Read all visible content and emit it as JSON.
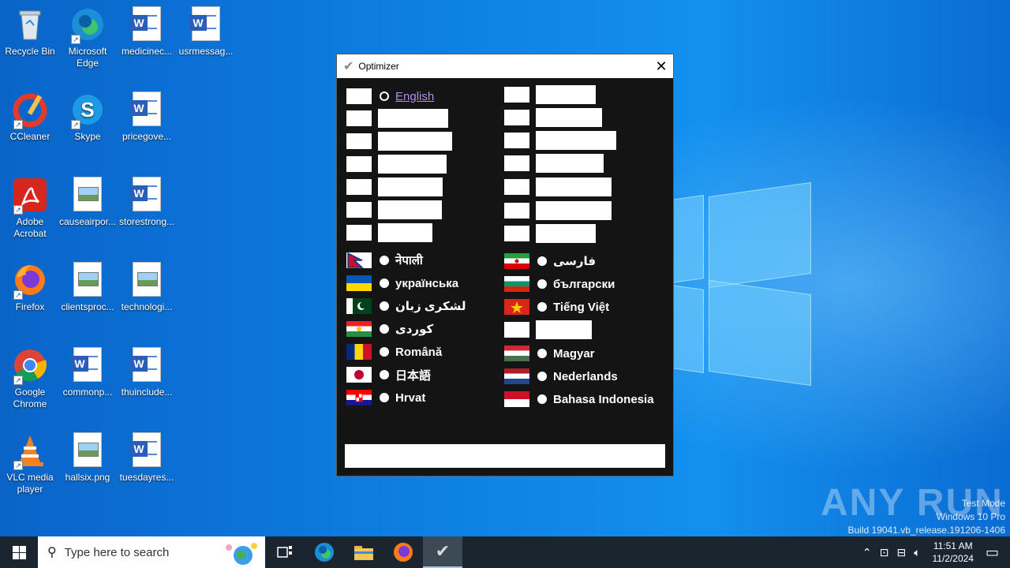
{
  "desktop": {
    "icons": [
      {
        "label": "Recycle Bin",
        "icon": "recycle-bin-icon"
      },
      {
        "label": "Microsoft Edge",
        "icon": "edge-icon"
      },
      {
        "label": "medicinec...",
        "icon": "word-doc-icon"
      },
      {
        "label": "usrmessag...",
        "icon": "word-doc-icon"
      },
      {
        "label": "CCleaner",
        "icon": "ccleaner-icon"
      },
      {
        "label": "Skype",
        "icon": "skype-icon"
      },
      {
        "label": "pricegove...",
        "icon": "word-doc-icon"
      },
      {
        "label": "Adobe Acrobat",
        "icon": "acrobat-icon"
      },
      {
        "label": "causeairpor...",
        "icon": "image-file-icon"
      },
      {
        "label": "storestrong...",
        "icon": "word-doc-icon"
      },
      {
        "label": "Firefox",
        "icon": "firefox-icon"
      },
      {
        "label": "clientsproc...",
        "icon": "image-file-icon"
      },
      {
        "label": "technologi...",
        "icon": "image-file-icon"
      },
      {
        "label": "Google Chrome",
        "icon": "chrome-icon"
      },
      {
        "label": "commonp...",
        "icon": "word-doc-icon"
      },
      {
        "label": "thuinclude...",
        "icon": "word-doc-icon"
      },
      {
        "label": "VLC media player",
        "icon": "vlc-icon"
      },
      {
        "label": "hallsix.png",
        "icon": "image-file-icon"
      },
      {
        "label": "tuesdayres...",
        "icon": "word-doc-icon"
      }
    ]
  },
  "window": {
    "title": "Optimizer",
    "close_glyph": "✕",
    "left_languages": [
      {
        "label": "English",
        "selected": true
      },
      {
        "label": "नेपाली",
        "flag": "nepal"
      },
      {
        "label": "українська",
        "flag": "ukraine"
      },
      {
        "label": "لشکری زبان",
        "flag": "pakistan"
      },
      {
        "label": "کوردی",
        "flag": "kurdistan"
      },
      {
        "label": "Română",
        "flag": "romania"
      },
      {
        "label": "日本語",
        "flag": "japan"
      },
      {
        "label": "Hrvat",
        "flag": "croatia"
      }
    ],
    "right_languages": [
      {
        "label": "فارسی",
        "flag": "iran"
      },
      {
        "label": "български",
        "flag": "bulgaria"
      },
      {
        "label": "Tiếng Việt",
        "flag": "vietnam"
      },
      {
        "label": "Magyar",
        "flag": "hungary"
      },
      {
        "label": "Nederlands",
        "flag": "netherlands"
      },
      {
        "label": "Bahasa Indonesia",
        "flag": "indonesia"
      }
    ]
  },
  "watermark": {
    "brand": "ANY RUN",
    "line1": "Test Mode",
    "line2": "Windows 10 Pro",
    "line3": "Build 19041.vb_release.191206-1406"
  },
  "taskbar": {
    "search_placeholder": "Type here to search",
    "time": "11:51 AM",
    "date": "11/2/2024"
  }
}
